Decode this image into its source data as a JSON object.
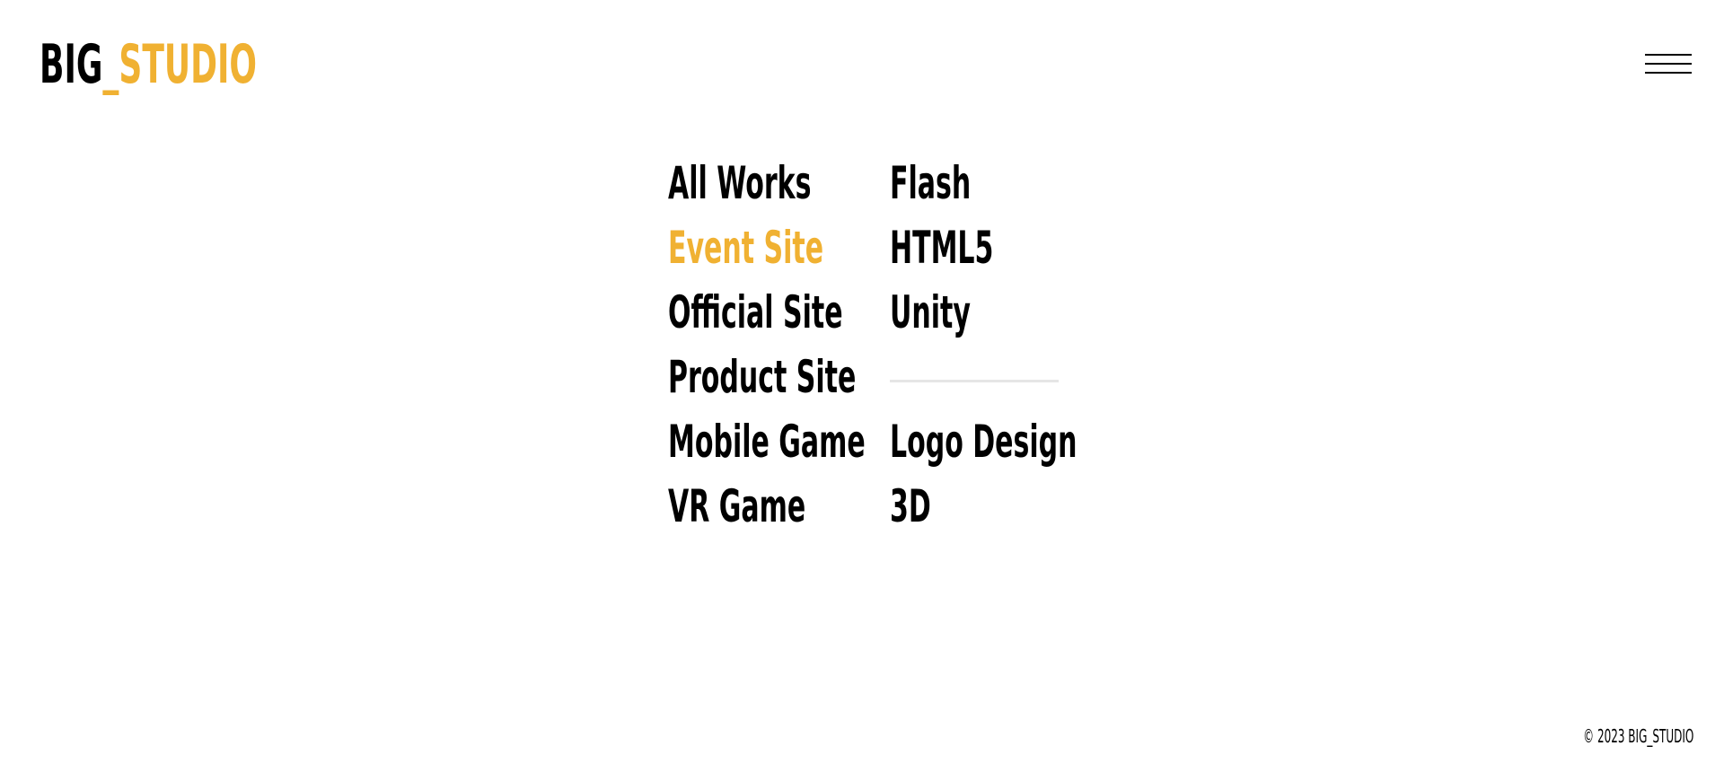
{
  "header": {
    "logo": {
      "part1": "BIG",
      "part2": "_STUDIO"
    },
    "menu_icon": "hamburger-menu-icon"
  },
  "categories": {
    "left": [
      {
        "label": "All Works",
        "active": false
      },
      {
        "label": "Event Site",
        "active": true
      },
      {
        "label": "Official Site",
        "active": false
      },
      {
        "label": "Product Site",
        "active": false
      },
      {
        "label": "Mobile Game",
        "active": false
      },
      {
        "label": "VR Game",
        "active": false
      }
    ],
    "right_top": [
      {
        "label": "Flash"
      },
      {
        "label": "HTML5"
      },
      {
        "label": "Unity"
      }
    ],
    "right_bottom": [
      {
        "label": "Logo Design"
      },
      {
        "label": "3D"
      }
    ]
  },
  "footer": {
    "copyright": "© 2023 BIG_STUDIO"
  },
  "colors": {
    "accent": "#F0B132",
    "text": "#000000",
    "divider": "#E6E6E6",
    "background": "#FFFFFF"
  }
}
